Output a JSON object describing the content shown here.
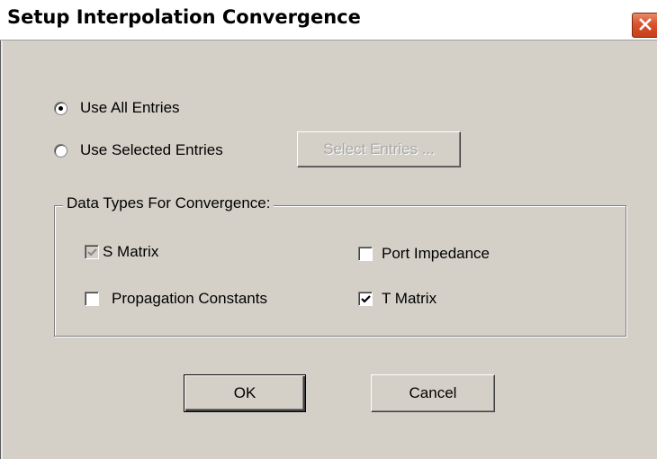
{
  "window": {
    "title": "Setup Interpolation Convergence"
  },
  "entries": {
    "use_all_label": "Use All Entries",
    "use_all_selected": true,
    "use_selected_label": "Use Selected Entries",
    "use_selected_selected": false,
    "select_entries_button": "Select Entries ...",
    "select_entries_enabled": false
  },
  "data_types": {
    "group_label": "Data Types For Convergence:",
    "s_matrix": {
      "label": "S Matrix",
      "checked": true,
      "enabled": false
    },
    "port_impedance": {
      "label": "Port Impedance",
      "checked": false,
      "enabled": true
    },
    "propagation_constants": {
      "label": "Propagation Constants",
      "checked": false,
      "enabled": true
    },
    "t_matrix": {
      "label": "T Matrix",
      "checked": true,
      "enabled": true
    }
  },
  "buttons": {
    "ok": "OK",
    "cancel": "Cancel"
  },
  "colors": {
    "dialog_face": "#d4d0c8",
    "close_button": "#d9542c",
    "disabled_text": "#a8a8a8"
  },
  "icons": {
    "close": "close-icon",
    "check": "checkmark-icon"
  }
}
